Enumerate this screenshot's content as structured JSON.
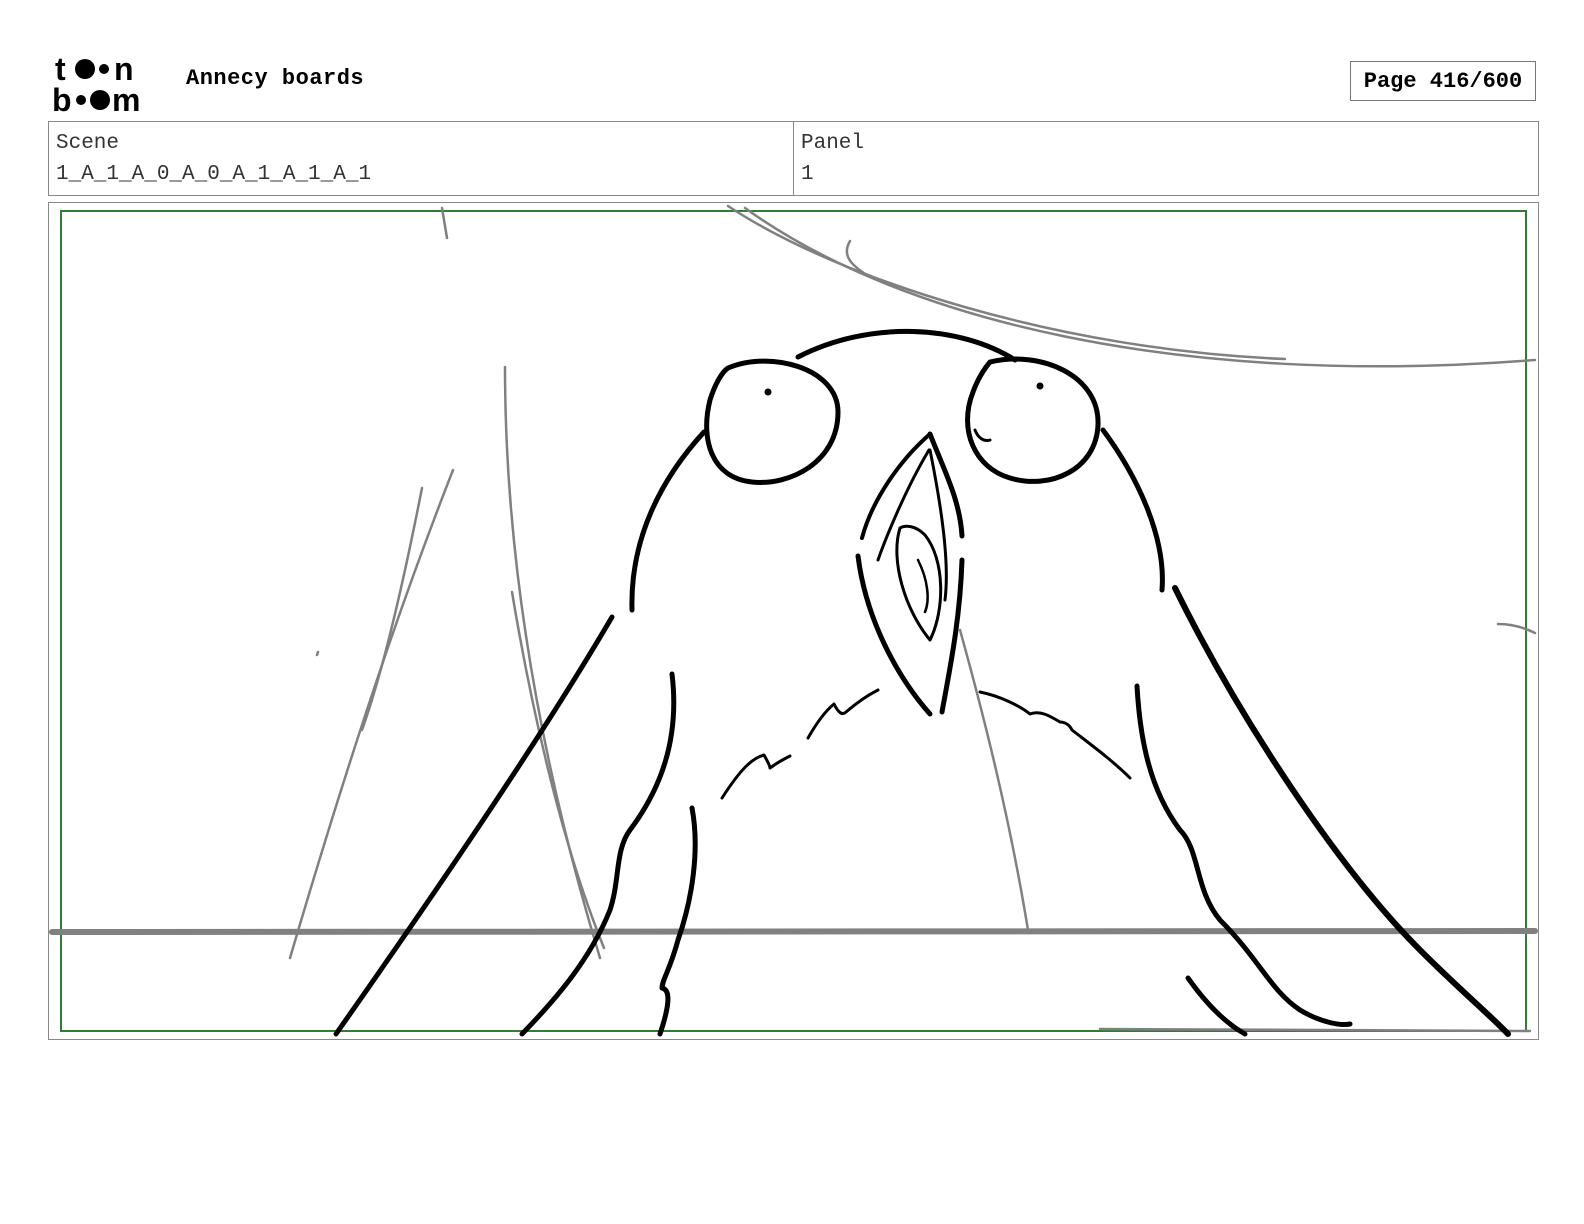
{
  "header": {
    "project_title": "Annecy boards",
    "page_counter": "Page 416/600",
    "logo_text": "toon boom",
    "logo_icon": "toon-boom-logo"
  },
  "info": {
    "scene_label": "Scene",
    "scene_value": "1_A_1_A_0_A_0_A_1_A_1_A_1",
    "panel_label": "Panel",
    "panel_value": "1"
  },
  "panel": {
    "safe_frame_color": "#2e7d32",
    "frame_border_color": "#888888",
    "sketch_line_color": "#000000",
    "guide_line_color": "#808080"
  }
}
